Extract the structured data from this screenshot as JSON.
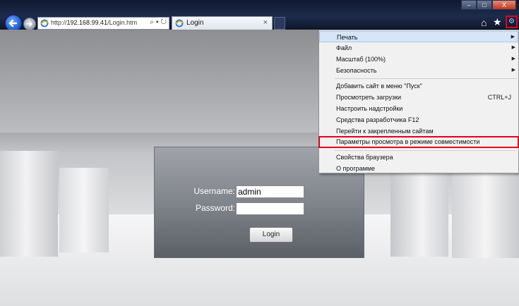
{
  "browser": {
    "address_prefix": "http://",
    "address_host": "192.168.99.41",
    "address_path": "/Login.htm",
    "address_tools": "⌕ ▾ ↻",
    "tab_title": "Login",
    "tab_close": "×",
    "minimize": "–",
    "maximize": "□",
    "close": "X"
  },
  "login": {
    "username_label": "Username:",
    "password_label": "Password:",
    "username_value": "admin",
    "password_value": "",
    "login_button": "Login"
  },
  "menu": {
    "items": [
      {
        "label": "Печать",
        "submenu": true
      },
      {
        "label": "Файл",
        "submenu": true
      },
      {
        "label": "Масштаб (100%)",
        "submenu": true
      },
      {
        "label": "Безопасность",
        "submenu": true
      },
      {
        "label": "Добавить сайт в меню \"Пуск\""
      },
      {
        "label": "Просмотреть загрузки",
        "shortcut": "CTRL+J"
      },
      {
        "label": "Настроить надстройки"
      },
      {
        "label": "Средства разработчика F12"
      },
      {
        "label": "Перейти к закрепленным сайтам"
      },
      {
        "label": "Параметры просмотра в режиме совместимости"
      },
      {
        "label": "Свойства браузера"
      },
      {
        "label": "О программе"
      }
    ],
    "submenu_arrow": "▶"
  },
  "colors": {
    "highlight_red": "#e3001b",
    "menu_bg": "#f1f1f1",
    "hover_bg": "#d6e5f7"
  },
  "icons": {
    "back": "back-arrow-icon",
    "forward": "forward-arrow-icon",
    "home": "home-icon",
    "favorites": "star-icon",
    "tools": "gear-icon"
  }
}
